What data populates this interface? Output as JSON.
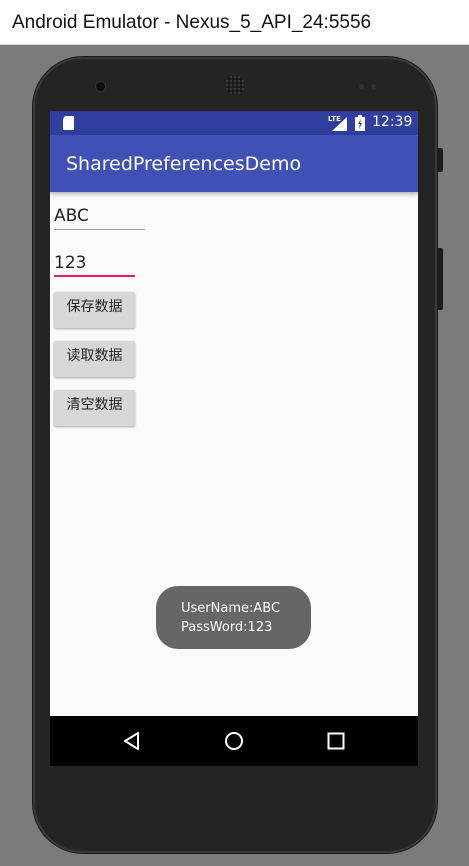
{
  "window": {
    "title": "Android Emulator - Nexus_5_API_24:5556"
  },
  "status_bar": {
    "time": "12:39",
    "network": "LTE",
    "icons": [
      "sd-card-icon",
      "signal-icon",
      "battery-icon"
    ]
  },
  "app_bar": {
    "title": "SharedPreferencesDemo"
  },
  "form": {
    "username_value": "ABC",
    "password_value": "123",
    "buttons": {
      "save": "保存数据",
      "read": "读取数据",
      "clear": "清空数据"
    }
  },
  "toast": {
    "line1": "UserName:ABC",
    "line2": "PassWord:123"
  },
  "nav_bar": {
    "icons": [
      "back-icon",
      "home-icon",
      "recents-icon"
    ]
  },
  "colors": {
    "primary": "#3f51b5",
    "primary_dark": "#303f9f",
    "accent": "#e91e63"
  }
}
